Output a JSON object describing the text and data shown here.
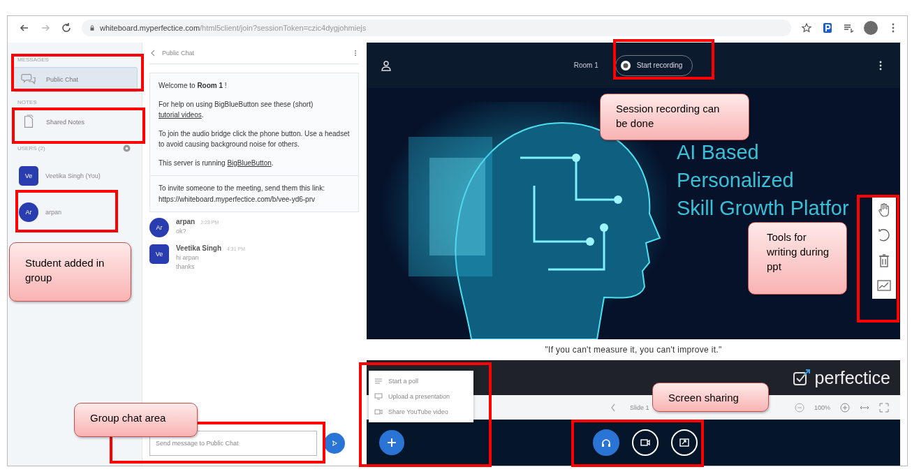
{
  "browser": {
    "url_host": "whiteboard.myperfectice.com",
    "url_path": "/html5client/join?sessionToken=czic4dygjohmiejs"
  },
  "sidebar": {
    "sections": [
      {
        "heading": "MESSAGES",
        "items": [
          {
            "label": "Public Chat",
            "kind": "chat",
            "selected": true
          }
        ]
      },
      {
        "heading": "NOTES",
        "items": [
          {
            "label": "Shared Notes",
            "kind": "notes",
            "selected": false
          }
        ]
      }
    ],
    "users_heading": "USERS (2)",
    "users": [
      {
        "initials": "Ve",
        "name": "Veetika Singh (You)",
        "kind": "moderator"
      },
      {
        "initials": "Ar",
        "name": "arpan",
        "kind": "viewer"
      }
    ]
  },
  "chat": {
    "title": "Public Chat",
    "welcome": [
      [
        {
          "text": "Welcome to **Room 1** !"
        }
      ],
      [
        {
          "text": "For help on using BigBlueButton see these (short) "
        },
        {
          "text": "tutorial videos",
          "link": true
        },
        {
          "text": "."
        }
      ],
      [
        {
          "text": "To join the audio bridge click the phone button. Use a headset to avoid causing background noise for others."
        }
      ],
      [
        {
          "text": "This server is running "
        },
        {
          "text": "BigBlueButton",
          "link": true
        },
        {
          "text": "."
        }
      ]
    ],
    "invite": "To invite someone to the meeting, send them this link: https://whiteboard.myperfectice.com/b/vee-yd6-prv",
    "messages": [
      {
        "initials": "Ar",
        "kind": "viewer",
        "author": "arpan",
        "time": "2:28 PM",
        "lines": [
          "ok?"
        ]
      },
      {
        "initials": "Ve",
        "kind": "moderator",
        "author": "Veetika Singh",
        "time": "4:31 PM",
        "lines": [
          "hi arpan",
          "thanks"
        ]
      }
    ],
    "input": {
      "placeholder": "Send message to Public Chat"
    }
  },
  "presentation": {
    "room": "Room 1",
    "record_label": "Start recording",
    "slide": {
      "title_lines": [
        "AI Based",
        "Personalized",
        "Skill Growth Platfor"
      ],
      "quote": "\"If you can't measure it, you can't improve it.\"",
      "brand": "perfectice"
    },
    "tools": [
      {
        "kind": "hand"
      },
      {
        "kind": "undo"
      },
      {
        "kind": "trash"
      },
      {
        "kind": "chart"
      }
    ],
    "nav": {
      "slide_label": "Slide 1",
      "zoom": "100%"
    },
    "actions_menu": [
      {
        "label": "Start a poll",
        "kind": "poll"
      },
      {
        "label": "Upload a presentation",
        "kind": "upload"
      },
      {
        "label": "Share YouTube video",
        "kind": "video"
      }
    ],
    "controls": [
      {
        "kind": "audio",
        "active": true
      },
      {
        "kind": "video",
        "active": false
      },
      {
        "kind": "screen",
        "active": false
      }
    ]
  },
  "callouts": [
    {
      "text": "Session recording can be done"
    },
    {
      "text": "Student added in group"
    },
    {
      "text": "Tools for writing during ppt"
    },
    {
      "text": "Group chat area"
    },
    {
      "text": "Screen sharing"
    }
  ]
}
